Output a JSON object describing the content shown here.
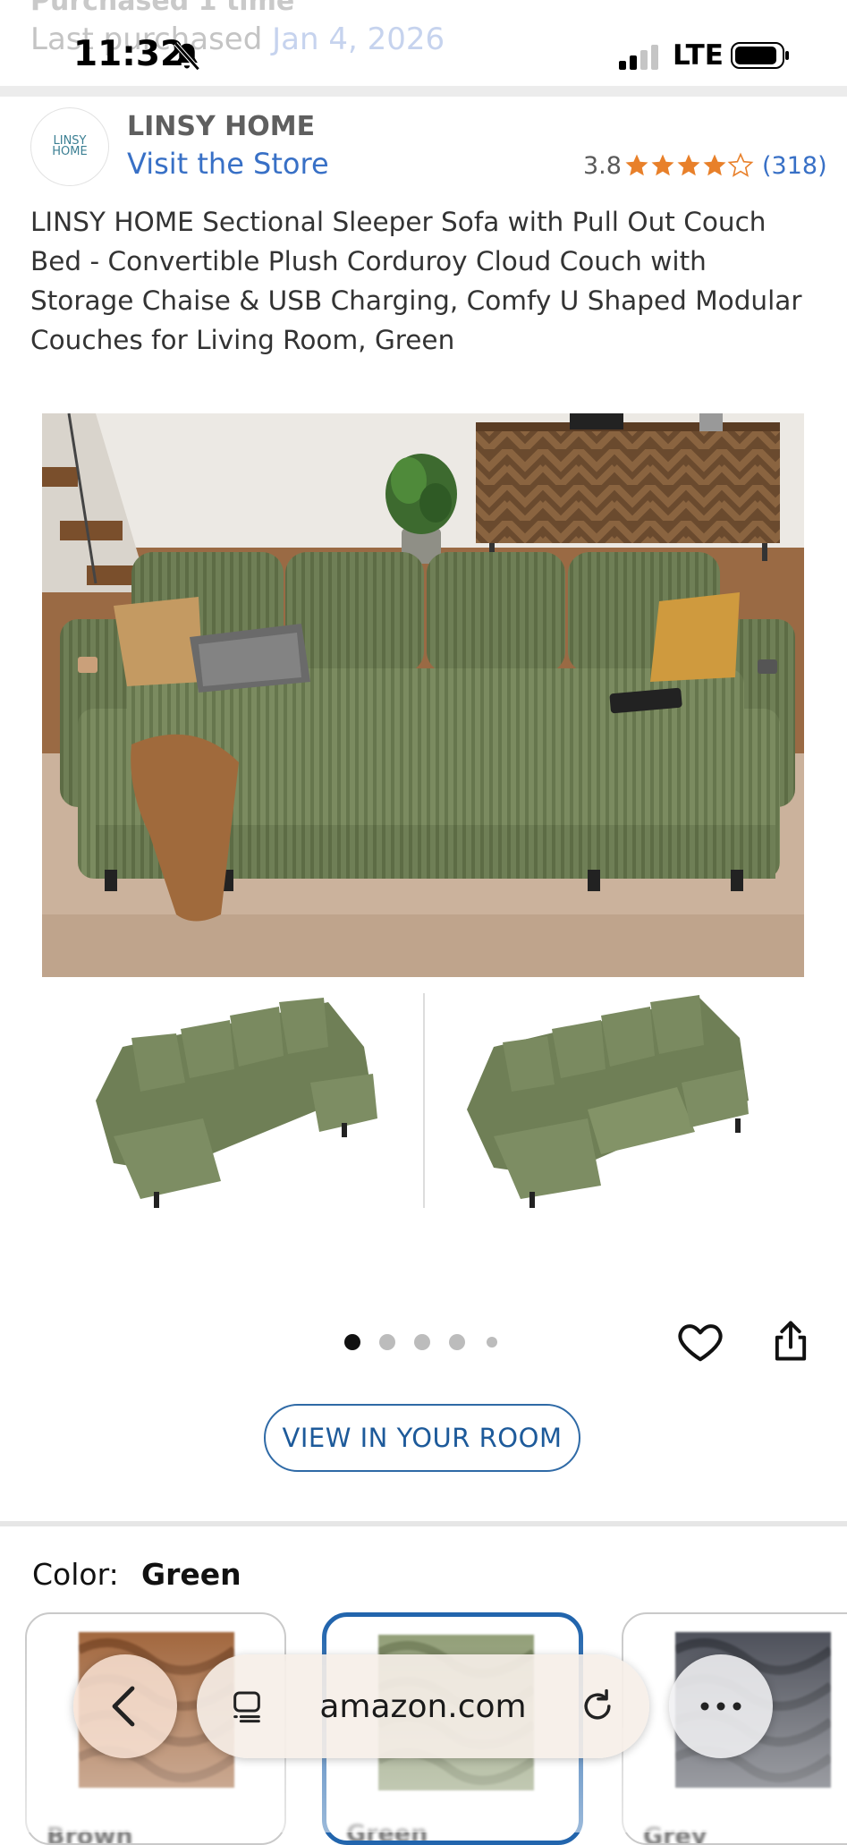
{
  "ghost_header": {
    "line1": "Purchased 1 time",
    "line2_prefix": "Last purchased",
    "line2_date": "Jan 4, 2026"
  },
  "status_bar": {
    "time": "11:32",
    "network": "LTE",
    "icons": [
      "bell-slash-icon",
      "signal-icon",
      "battery-icon"
    ]
  },
  "brand": {
    "logo_text": "LINSY HOME",
    "name": "LINSY HOME",
    "store_link": "Visit the Store",
    "rating": "3.8",
    "rating_stars": 3.8,
    "rating_count": "(318)"
  },
  "product": {
    "title": "LINSY HOME Sectional Sleeper Sofa with Pull Out Couch Bed - Convertible Plush Corduroy Cloud Couch with Storage Chaise & USB Charging, Comfy U Shaped Modular Couches for Living Room, Green"
  },
  "gallery": {
    "image_count": 5,
    "active_index": 0
  },
  "actions": {
    "view_room": "VIEW IN YOUR ROOM"
  },
  "color_selector": {
    "label": "Color:",
    "selected": "Green",
    "swatches": [
      {
        "name": "Brown",
        "color": "#a0643a"
      },
      {
        "name": "Green",
        "color": "#7e8d62"
      },
      {
        "name": "Grey",
        "color": "#4a4d57"
      }
    ]
  },
  "browser": {
    "url": "amazon.com"
  },
  "colors": {
    "link": "#3870c6",
    "star": "#e8802a",
    "accent_border": "#2265ad",
    "sofa_green": "#6f7f56"
  }
}
